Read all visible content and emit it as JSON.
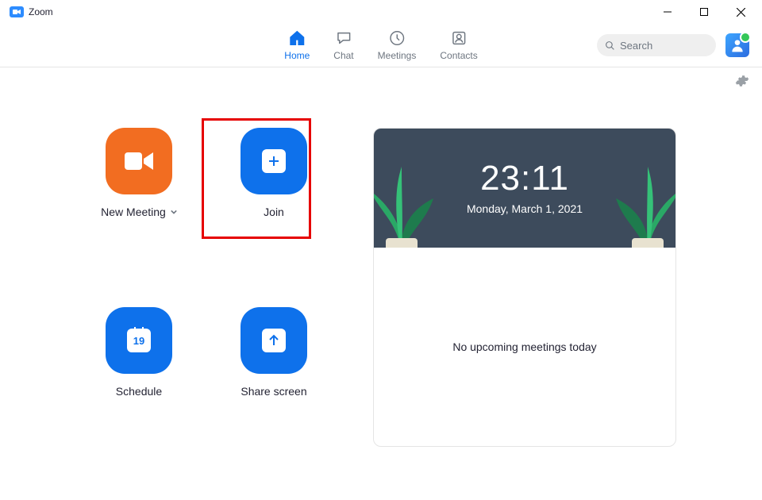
{
  "window": {
    "title": "Zoom"
  },
  "nav": {
    "home": {
      "label": "Home"
    },
    "chat": {
      "label": "Chat"
    },
    "meetings": {
      "label": "Meetings"
    },
    "contacts": {
      "label": "Contacts"
    }
  },
  "search": {
    "placeholder": "Search"
  },
  "actions": {
    "new_meeting": {
      "label": "New Meeting"
    },
    "join": {
      "label": "Join"
    },
    "schedule": {
      "label": "Schedule",
      "day": "19"
    },
    "share_screen": {
      "label": "Share screen"
    }
  },
  "panel": {
    "time": "23:11",
    "date": "Monday, March 1, 2021",
    "empty_state": "No upcoming meetings today"
  }
}
